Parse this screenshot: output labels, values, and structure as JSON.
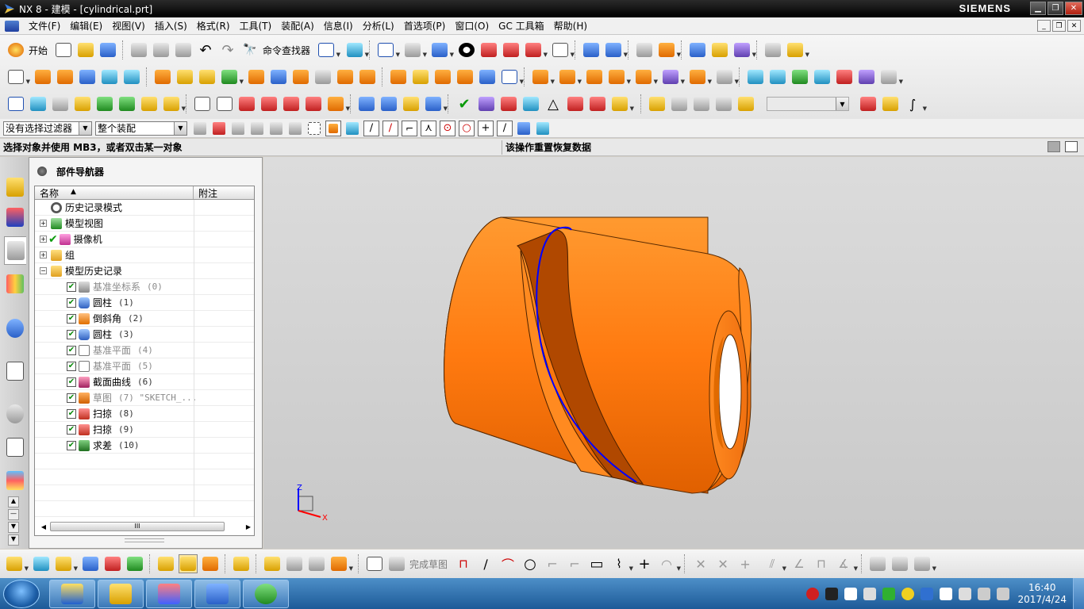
{
  "window": {
    "title": "NX 8 - 建模 - [cylindrical.prt]",
    "brand": "SIEMENS"
  },
  "menu": [
    "文件(F)",
    "编辑(E)",
    "视图(V)",
    "插入(S)",
    "格式(R)",
    "工具(T)",
    "装配(A)",
    "信息(I)",
    "分析(L)",
    "首选项(P)",
    "窗口(O)",
    "GC 工具箱",
    "帮助(H)"
  ],
  "toolbar": {
    "start_label": "开始",
    "command_finder_label": "命令查找器"
  },
  "selection": {
    "filter_value": "没有选择过滤器",
    "scope_value": "整个装配"
  },
  "status": {
    "prompt": "选择对象并使用 MB3，或者双击某一对象",
    "message": "该操作重置恢复数据"
  },
  "navigator": {
    "title": "部件导航器",
    "col_name": "名称",
    "col_notes": "附注",
    "rows": [
      {
        "label": "历史记录模式",
        "num": "",
        "dim": false
      },
      {
        "label": "模型视图",
        "num": "",
        "dim": false
      },
      {
        "label": "摄像机",
        "num": "",
        "dim": false
      },
      {
        "label": "组",
        "num": "",
        "dim": false
      },
      {
        "label": "模型历史记录",
        "num": "",
        "dim": false
      },
      {
        "label": "基准坐标系",
        "num": "(0)",
        "dim": true
      },
      {
        "label": "圆柱",
        "num": "(1)",
        "dim": false
      },
      {
        "label": "倒斜角",
        "num": "(2)",
        "dim": false
      },
      {
        "label": "圆柱",
        "num": "(3)",
        "dim": false
      },
      {
        "label": "基准平面",
        "num": "(4)",
        "dim": true
      },
      {
        "label": "基准平面",
        "num": "(5)",
        "dim": true
      },
      {
        "label": "截面曲线",
        "num": "(6)",
        "dim": false
      },
      {
        "label": "草图",
        "num": "(7) \"SKETCH_...",
        "dim": true
      },
      {
        "label": "扫掠",
        "num": "(8)",
        "dim": false
      },
      {
        "label": "扫掠",
        "num": "(9)",
        "dim": false
      },
      {
        "label": "求差",
        "num": "(10)",
        "dim": false
      }
    ],
    "scroll_glyph": "III"
  },
  "graphics": {
    "triad_z": "Z",
    "triad_x": "X",
    "part_color": "#ff7a10",
    "curve_color": "#0000ff"
  },
  "bottombar": {
    "finish_sketch_label": "完成草图"
  },
  "taskbar": {
    "time": "16:40",
    "date": "2017/4/24"
  }
}
